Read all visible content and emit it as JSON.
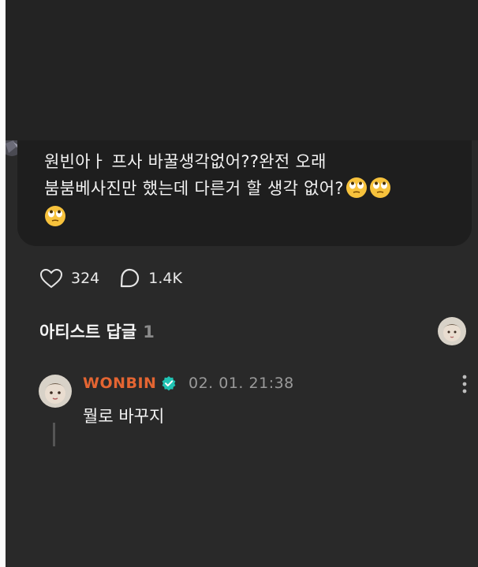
{
  "post": {
    "line1": "원빈아ㅏ 프사 바꿀생각없어??완전 오래",
    "line2": "붐붐베사진만 했는데 다른거 할 생각 없어?",
    "emoji": "eye-roll"
  },
  "stats": {
    "likes": "324",
    "comments": "1.4K"
  },
  "artist_replies": {
    "title": "아티스트 답글",
    "count": "1"
  },
  "comment": {
    "author": "WONBIN",
    "time": "02. 01. 21:38",
    "text": "뭘로 바꾸지"
  },
  "colors": {
    "accent": "#e46532",
    "verified": "#20c3b3",
    "background": "#292929",
    "card": "#1e1e1e"
  }
}
